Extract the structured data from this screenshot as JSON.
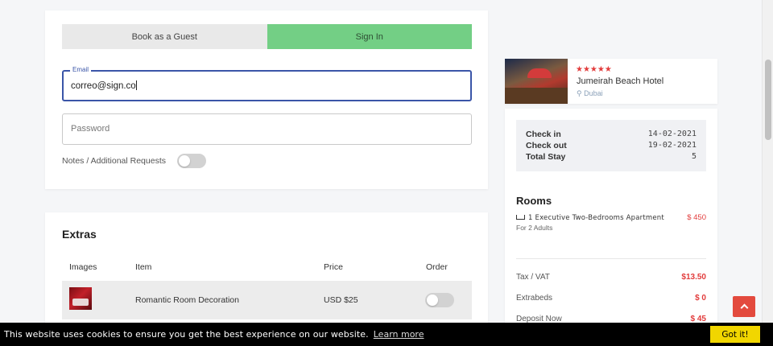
{
  "booking": {
    "tabs": {
      "guest": "Book as a Guest",
      "signin": "Sign In"
    },
    "email": {
      "label": "Email",
      "value": "correo@sign.co"
    },
    "password": {
      "placeholder": "Password"
    },
    "notes_label": "Notes / Additional Requests"
  },
  "extras": {
    "title": "Extras",
    "columns": {
      "images": "Images",
      "item": "Item",
      "price": "Price",
      "order": "Order"
    },
    "rows": [
      {
        "item": "Romantic Room Decoration",
        "price": "USD $25"
      }
    ]
  },
  "hotel": {
    "stars": "★★★★★",
    "name": "Jumeirah Beach Hotel",
    "location": "Dubai"
  },
  "stay": {
    "checkin_label": "Check in",
    "checkin_value": "14-02-2021",
    "checkout_label": "Check out",
    "checkout_value": "19-02-2021",
    "total_label": "Total Stay",
    "total_value": "5"
  },
  "rooms": {
    "title": "Rooms",
    "items": [
      {
        "name": "1 Executive Two-Bedrooms Apartment",
        "guests": "For 2 Adults",
        "price": "$ 450"
      }
    ]
  },
  "summary": {
    "tax_label": "Tax / VAT",
    "tax_value": "$13.50",
    "extrabeds_label": "Extrabeds",
    "extrabeds_value": "$ 0",
    "deposit_label": "Deposit Now",
    "deposit_value": "$ 45"
  },
  "cookie": {
    "text": "This website uses cookies to ensure you get the best experience on our website.",
    "link": "Learn more",
    "button": "Got it!"
  },
  "colors": {
    "accent_green": "#73cf85",
    "accent_red": "#e23c3c",
    "focus_blue": "#3a55a8",
    "cookie_button": "#f1d600"
  }
}
